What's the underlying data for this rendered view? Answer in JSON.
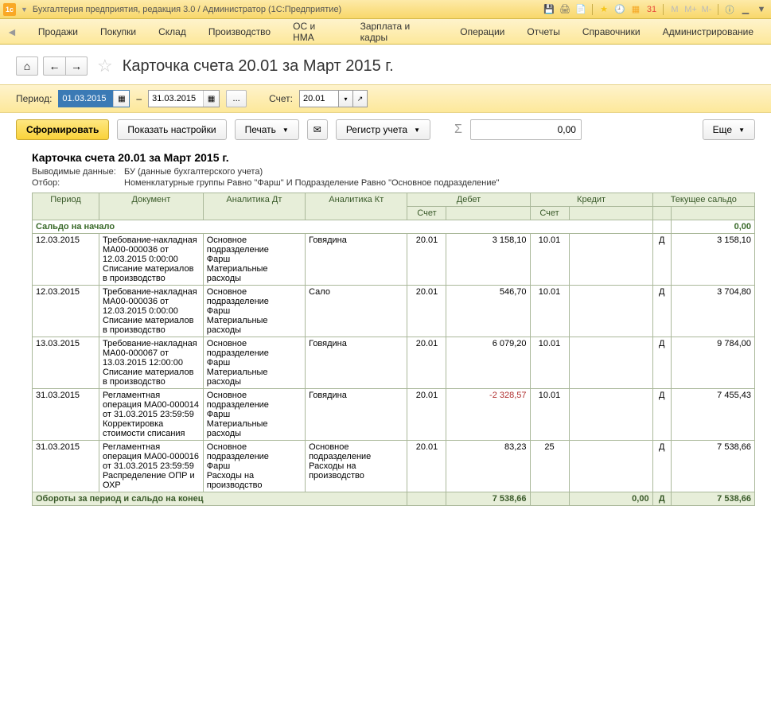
{
  "titlebar": {
    "text": "Бухгалтерия предприятия, редакция 3.0 / Администратор  (1С:Предприятие)"
  },
  "mainmenu": {
    "items": [
      "Продажи",
      "Покупки",
      "Склад",
      "Производство",
      "ОС и НМА",
      "Зарплата и кадры",
      "Операции",
      "Отчеты",
      "Справочники",
      "Администрирование"
    ]
  },
  "page": {
    "title": "Карточка счета 20.01 за Март 2015 г."
  },
  "filter": {
    "period_label": "Период:",
    "date_from": "01.03.2015",
    "date_to": "31.03.2015",
    "account_label": "Счет:",
    "account": "20.01"
  },
  "actions": {
    "generate": "Сформировать",
    "show_settings": "Показать настройки",
    "print": "Печать",
    "register": "Регистр учета",
    "sum_value": "0,00",
    "more": "Еще"
  },
  "report": {
    "title": "Карточка счета 20.01 за Март 2015 г.",
    "output_label": "Выводимые данные:",
    "output_value": "БУ (данные бухгалтерского учета)",
    "filter_label": "Отбор:",
    "filter_value": "Номенклатурные группы Равно \"Фарш\" И Подразделение Равно \"Основное подразделение\""
  },
  "table": {
    "headers": {
      "period": "Период",
      "document": "Документ",
      "analytics_dt": "Аналитика Дт",
      "analytics_kt": "Аналитика Кт",
      "debit": "Дебет",
      "credit": "Кредит",
      "balance": "Текущее сальдо",
      "account": "Счет"
    },
    "opening": {
      "label": "Сальдо на начало",
      "value": "0,00"
    },
    "rows": [
      {
        "period": "12.03.2015",
        "document": "Требование-накладная МА00-000036 от 12.03.2015 0:00:00\nСписание материалов в производство",
        "dt": "Основное подразделение\nФарш\nМатериальные расходы",
        "kt": "Говядина",
        "debit_acct": "20.01",
        "debit_sum": "3 158,10",
        "credit_acct": "10.01",
        "credit_sum": "",
        "dc": "Д",
        "balance": "3 158,10"
      },
      {
        "period": "12.03.2015",
        "document": "Требование-накладная МА00-000036 от 12.03.2015 0:00:00\nСписание материалов в производство",
        "dt": "Основное подразделение\nФарш\nМатериальные расходы",
        "kt": "Сало",
        "debit_acct": "20.01",
        "debit_sum": "546,70",
        "credit_acct": "10.01",
        "credit_sum": "",
        "dc": "Д",
        "balance": "3 704,80"
      },
      {
        "period": "13.03.2015",
        "document": "Требование-накладная МА00-000067 от 13.03.2015 12:00:00\nСписание материалов в производство",
        "dt": "Основное подразделение\nФарш\nМатериальные расходы",
        "kt": "Говядина",
        "debit_acct": "20.01",
        "debit_sum": "6 079,20",
        "credit_acct": "10.01",
        "credit_sum": "",
        "dc": "Д",
        "balance": "9 784,00"
      },
      {
        "period": "31.03.2015",
        "document": "Регламентная операция МА00-000014 от 31.03.2015 23:59:59\nКорректировка стоимости списания",
        "dt": "Основное подразделение\nФарш\nМатериальные расходы",
        "kt": "Говядина",
        "debit_acct": "20.01",
        "debit_sum": "-2 328,57",
        "debit_neg": true,
        "credit_acct": "10.01",
        "credit_sum": "",
        "dc": "Д",
        "balance": "7 455,43"
      },
      {
        "period": "31.03.2015",
        "document": "Регламентная операция МА00-000016 от 31.03.2015 23:59:59\nРаспределение ОПР и ОХР",
        "dt": "Основное подразделение\nФарш\nРасходы на производство",
        "kt": "Основное подразделение\nРасходы на производство",
        "debit_acct": "20.01",
        "debit_sum": "83,23",
        "credit_acct": "25",
        "credit_sum": "",
        "dc": "Д",
        "balance": "7 538,66"
      }
    ],
    "totals": {
      "label": "Обороты за период и сальдо на конец",
      "debit": "7 538,66",
      "credit": "0,00",
      "dc": "Д",
      "balance": "7 538,66"
    }
  }
}
